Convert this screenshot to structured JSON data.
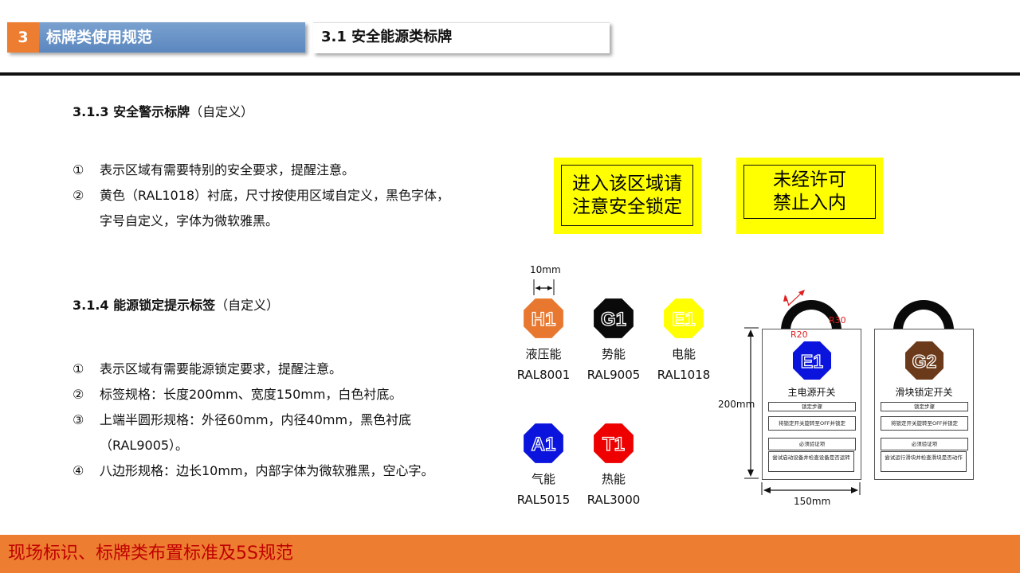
{
  "header": {
    "section_number": "3",
    "section_title": "标牌类使用规范",
    "subsection_title": "3.1 安全能源类标牌"
  },
  "section_313": {
    "heading_bold": "3.1.3 安全警示标牌",
    "heading_suffix": "（自定义）",
    "items": [
      {
        "marker": "①",
        "text": "表示区域有需要特别的安全要求，提醒注意。"
      },
      {
        "marker": "②",
        "text": "黄色（RAL1018）衬底，尺寸按使用区域自定义，黑色字体，"
      },
      {
        "marker": "",
        "text": "字号自定义，字体为微软雅黑。"
      }
    ]
  },
  "section_314": {
    "heading_bold": "3.1.4 能源锁定提示标签",
    "heading_suffix": "（自定义）",
    "items": [
      {
        "marker": "①",
        "text": "表示区域有需要能源锁定要求，提醒注意。"
      },
      {
        "marker": "②",
        "text": "标签规格：长度200mm、宽度150mm，白色衬底。"
      },
      {
        "marker": "③",
        "text": "上端半圆形规格：外径60mm，内径40mm，黑色衬底"
      },
      {
        "marker": "",
        "text": "（RAL9005）。"
      },
      {
        "marker": "④",
        "text": "八边形规格：边长10mm，内部字体为微软雅黑，空心字。"
      }
    ]
  },
  "signs": [
    {
      "line1": "进入该区域请",
      "line2": "注意安全锁定"
    },
    {
      "line1": "未经许可",
      "line2": "禁止入内"
    }
  ],
  "sign_color": "#ffff00",
  "dimension_10mm": "10mm",
  "octagons": [
    {
      "code": "H1",
      "name": "液压能",
      "ral": "RAL8001",
      "color": "#e8782f"
    },
    {
      "code": "G1",
      "name": "势能",
      "ral": "RAL9005",
      "color": "#0a0a0a"
    },
    {
      "code": "E1",
      "name": "电能",
      "ral": "RAL1018",
      "color": "#ffff00"
    },
    {
      "code": "A1",
      "name": "气能",
      "ral": "RAL5015",
      "color": "#0a14dc"
    },
    {
      "code": "T1",
      "name": "热能",
      "ral": "RAL3000",
      "color": "#ee0000"
    }
  ],
  "tags": [
    {
      "code": "E1",
      "color": "#0a14dc",
      "title": "主电源开关",
      "step_label": "锁定步骤",
      "step_text": "将锁定开关旋转至OFF并锁定",
      "verify_label": "必须验证项",
      "verify_text": "尝试启动设备并检查设备是否运转"
    },
    {
      "code": "G2",
      "color": "#6b3a1a",
      "title": "滑块锁定开关",
      "step_label": "锁定步骤",
      "step_text": "将锁定开关旋转至OFF并锁定",
      "verify_label": "必须验证项",
      "verify_text": "尝试运行滑块并检查滑块是否动作"
    }
  ],
  "tag_dims": {
    "r30": "R30",
    "r20": "R20",
    "height": "200mm",
    "width": "150mm"
  },
  "footer": {
    "text": "现场标识、标牌类布置标准及5S规范"
  }
}
